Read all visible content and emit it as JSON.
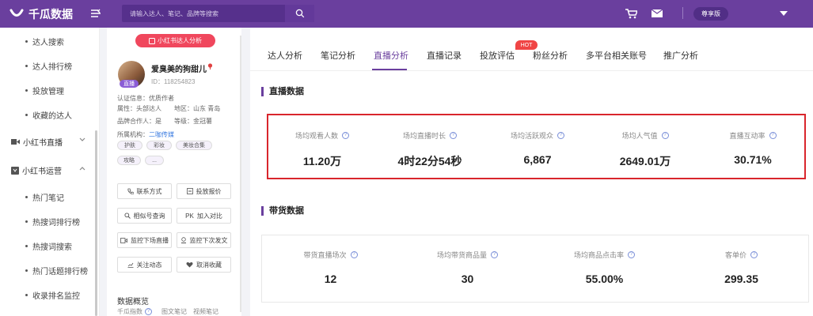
{
  "brand": {
    "name": "千瓜数据"
  },
  "search": {
    "placeholder": "请输入达人、笔记、品牌等搜索"
  },
  "header": {
    "vip_label": "尊享版"
  },
  "sidebar": {
    "items_top": [
      "达人搜索",
      "达人排行榜",
      "投放管理",
      "收藏的达人"
    ],
    "group_live": "小红书直播",
    "group_ops": "小红书运营",
    "items_ops": [
      "热门笔记",
      "热搜词排行榜",
      "热搜词搜索",
      "热门话题排行榜",
      "收录排名监控"
    ]
  },
  "profile": {
    "xhs_tag": "小红书达人分析",
    "name": "爱臭美的狗甜儿",
    "id_text": "ID：118254823",
    "live_badge": "直播",
    "cert": "认证信息：优质作者",
    "attr_label": "属性：头部达人",
    "region_label": "地区：山东 青岛",
    "brand_coop": "品牌合作人：是",
    "level_label": "等级：金冠薯",
    "org_prefix": "所属机构：",
    "org_link": "二咖传媒",
    "tags": [
      "护肤",
      "彩妆",
      "美妆合集",
      "攻略",
      "..."
    ],
    "buttons": [
      "联系方式",
      "投放报价",
      "相似号查询",
      "加入对比",
      "监控下场直播",
      "监控下次发文",
      "关注动态",
      "取消收藏"
    ],
    "data_section": "数据概览",
    "sub_links": [
      "千瓜指数",
      "图文笔记",
      "视频笔记"
    ]
  },
  "tabs": [
    "达人分析",
    "笔记分析",
    "直播分析",
    "直播记录",
    "投放评估",
    "粉丝分析",
    "多平台相关账号",
    "推广分析"
  ],
  "hot_badge": "HOT",
  "live_data": {
    "title": "直播数据",
    "stats": [
      {
        "label": "场均观看人数",
        "value": "11.20万"
      },
      {
        "label": "场均直播时长",
        "value": "4时22分54秒"
      },
      {
        "label": "场均活跃观众",
        "value": "6,867"
      },
      {
        "label": "场均人气值",
        "value": "2649.01万"
      },
      {
        "label": "直播互动率",
        "value": "30.71%"
      }
    ]
  },
  "goods_data": {
    "title": "带货数据",
    "stats": [
      {
        "label": "带货直播场次",
        "value": "12"
      },
      {
        "label": "场均带货商品量",
        "value": "30"
      },
      {
        "label": "场均商品点击率",
        "value": "55.00%"
      },
      {
        "label": "客单价",
        "value": "299.35"
      }
    ]
  },
  "colors": {
    "brand": "#6a3f9e",
    "highlight_border": "#d9262c",
    "hot": "#f04545",
    "xhs_red": "#f0475d"
  }
}
